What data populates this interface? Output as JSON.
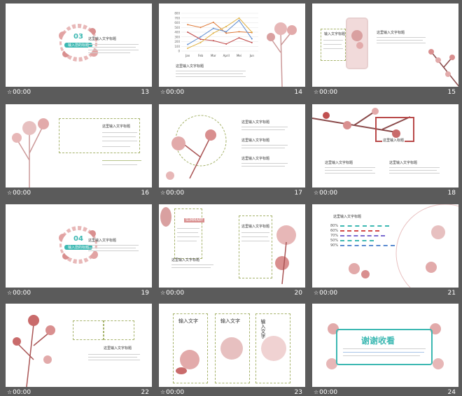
{
  "slides": [
    {
      "number": "13",
      "time": "00:00",
      "badge_number": "03",
      "badge_text": "输入您的标题",
      "heading": "这里输入文字标题"
    },
    {
      "number": "14",
      "time": "00:00",
      "heading": "这里输入文字标题"
    },
    {
      "number": "15",
      "time": "00:00",
      "box_title": "输入文字标题",
      "heading": "这里输入文字标题"
    },
    {
      "number": "16",
      "time": "00:00",
      "heading": "这里输入文字标题"
    },
    {
      "number": "17",
      "time": "00:00",
      "heading_1": "这里输入文字标题",
      "heading_2": "这里输入文字标题",
      "heading_3": "这里输入文字标题"
    },
    {
      "number": "18",
      "time": "00:00",
      "frame_title": "这里输入标题",
      "heading_1": "这里输入文字标题",
      "heading_2": "这里输入文字标题"
    },
    {
      "number": "19",
      "time": "00:00",
      "badge_number": "04",
      "badge_text": "输入您的标题",
      "heading": "这里输入文字标题"
    },
    {
      "number": "20",
      "time": "00:00",
      "box_label": "SUMMARY",
      "heading_1": "这里输入文字标题",
      "heading_2": "这里输入文字标题"
    },
    {
      "number": "21",
      "time": "00:00",
      "heading": "这里输入文字标题",
      "bar_labels": [
        "80%",
        "60%",
        "70%",
        "50%",
        "90%"
      ]
    },
    {
      "number": "22",
      "time": "00:00",
      "heading": "这里输入文字标题"
    },
    {
      "number": "23",
      "time": "00:00",
      "col_title_1": "输入文字",
      "col_title_2": "输入文字",
      "col_title_3": "输入文字"
    },
    {
      "number": "24",
      "time": "00:00",
      "thanks": "谢谢收看"
    }
  ],
  "chart_data": {
    "type": "line",
    "categories": [
      "Jan",
      "Feb",
      "Mar",
      "April",
      "Mei",
      "Jun"
    ],
    "ylim": [
      0,
      800
    ],
    "yticks": [
      "800",
      "700",
      "600",
      "500",
      "400",
      "300",
      "200",
      "100",
      "0"
    ],
    "series": [
      {
        "values": [
          560,
          500,
          610,
          380,
          410,
          390
        ],
        "color": "#e07b39"
      },
      {
        "values": [
          140,
          300,
          480,
          410,
          650,
          260
        ],
        "color": "#5b8bd0"
      },
      {
        "values": [
          400,
          250,
          220,
          150,
          280,
          180
        ],
        "color": "#c04848"
      },
      {
        "values": [
          60,
          180,
          380,
          520,
          700,
          400
        ],
        "color": "#e0b040"
      }
    ]
  },
  "colors": {
    "accent": "#3cb8b2",
    "flower": "#c47a7a",
    "dash_border": "#a6b36b"
  }
}
